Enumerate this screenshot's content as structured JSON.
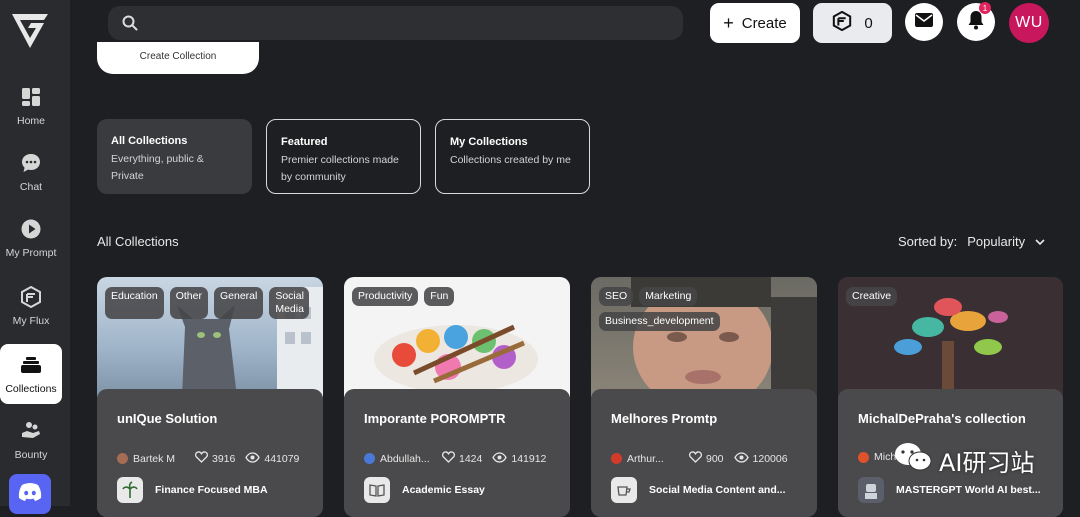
{
  "sidebar": {
    "items": [
      {
        "label": "Home",
        "icon": "dashboard-icon"
      },
      {
        "label": "Chat",
        "icon": "chat-bubble-icon"
      },
      {
        "label": "My Prompt",
        "icon": "play-circle-icon"
      },
      {
        "label": "My Flux",
        "icon": "flux-logo-icon"
      },
      {
        "label": "Collections",
        "icon": "stack-icon",
        "active": true
      },
      {
        "label": "Bounty",
        "icon": "hand-coins-icon"
      }
    ],
    "discord_icon": "discord-icon"
  },
  "header": {
    "search_placeholder": "",
    "create_label": "Create",
    "credits_value": "0",
    "notification_count": "1",
    "avatar_initials": "WU"
  },
  "create_collection_label": "Create Collection",
  "filters": [
    {
      "title": "All Collections",
      "desc": "Everything, public & Private",
      "active": true
    },
    {
      "title": "Featured",
      "desc": "Premier collections made by community",
      "active": false
    },
    {
      "title": "My Collections",
      "desc": "Collections created by me",
      "active": false
    }
  ],
  "section_title": "All Collections",
  "sort": {
    "label": "Sorted by:",
    "value": "Popularity"
  },
  "cards": [
    {
      "tags": [
        "Education",
        "Other",
        "General",
        "Social Media"
      ],
      "name": "unIQue Solution",
      "author": "Bartek M",
      "likes": "3916",
      "views": "441079",
      "prompt": "Finance Focused MBA"
    },
    {
      "tags": [
        "Productivity",
        "Fun"
      ],
      "name": "Imporante POROMPTR",
      "author": "Abdullah...",
      "likes": "1424",
      "views": "141912",
      "prompt": "Academic Essay"
    },
    {
      "tags": [
        "SEO",
        "Marketing",
        "Business_development"
      ],
      "name": "Melhores Promtp",
      "author": "Arthur...",
      "likes": "900",
      "views": "120006",
      "prompt": "Social Media Content and..."
    },
    {
      "tags": [
        "Creative"
      ],
      "name": "MichalDePraha's collection",
      "author": "Mich",
      "likes": "",
      "views": "",
      "prompt": "MASTERGPT World AI best..."
    }
  ],
  "watermark": "AI研习站",
  "colors": {
    "background": "#1e1f22",
    "sidebar": "#2a2b2e",
    "avatar": "#c8175d",
    "discord": "#5865f2"
  }
}
